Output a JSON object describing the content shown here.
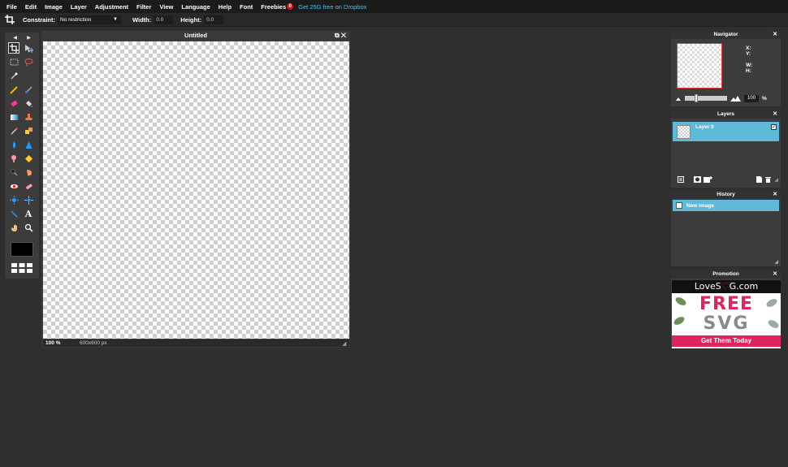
{
  "menubar": {
    "items": [
      "File",
      "Edit",
      "Image",
      "Layer",
      "Adjustment",
      "Filter",
      "View",
      "Language",
      "Help",
      "Font",
      "Freebies"
    ],
    "freebies_badge": "0",
    "dropbox_link": "Get 25G free on Dropbox"
  },
  "options": {
    "constraint_label": "Constraint:",
    "constraint_value": "No restriction",
    "width_label": "Width:",
    "width_value": "0.0",
    "height_label": "Height:",
    "height_value": "0.0"
  },
  "document": {
    "title": "Untitled",
    "zoom": "100 %",
    "size": "600x600 px"
  },
  "navigator": {
    "title": "Navigator",
    "x_label": "X:",
    "y_label": "Y:",
    "w_label": "W:",
    "h_label": "H:",
    "zoom_value": "100",
    "zoom_unit": "%"
  },
  "layers": {
    "title": "Layers",
    "items": [
      {
        "name": "Layer 0",
        "visible": true
      }
    ]
  },
  "history": {
    "title": "History",
    "items": [
      {
        "label": "New image"
      }
    ]
  },
  "promotion": {
    "title": "Promotion",
    "brand_left": "LoveS",
    "brand_right": "G.com",
    "line1": "FREE",
    "line2": "SVG",
    "cta": "Get Them Today"
  },
  "colors": {
    "accent": "#5fb9d9",
    "link": "#5fb9e6",
    "promo_pink": "#e0245e"
  }
}
